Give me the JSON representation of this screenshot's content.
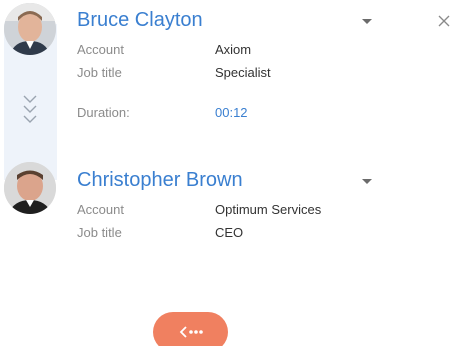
{
  "contacts": [
    {
      "name": "Bruce Clayton",
      "fields": [
        {
          "label": "Account",
          "value": "Axiom"
        },
        {
          "label": "Job title",
          "value": "Specialist"
        }
      ],
      "duration_label": "Duration:",
      "duration_value": "00:12"
    },
    {
      "name": "Christopher Brown",
      "fields": [
        {
          "label": "Account",
          "value": "Optimum Services"
        },
        {
          "label": "Job title",
          "value": "CEO"
        }
      ]
    }
  ],
  "icons": {
    "close": "close-icon",
    "expand": "chevrons-down-icon",
    "caret": "caret-down-icon",
    "fab": "back-arrow-icon"
  },
  "colors": {
    "name": "#3a7fd0",
    "link": "#3a7fd0",
    "label": "#8b8b8b",
    "fab": "#f08060",
    "rail": "#eef3fa"
  }
}
